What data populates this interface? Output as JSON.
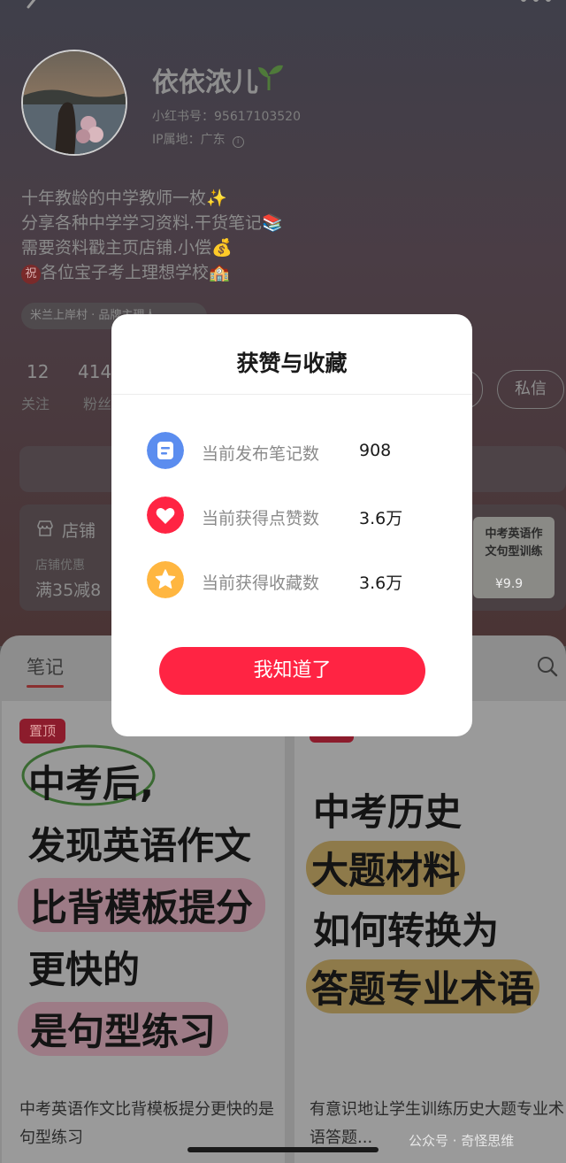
{
  "profile": {
    "nickname": "依依浓儿",
    "red_id": "小红书号：95617103520",
    "ip_location": "IP属地：广东",
    "bio": [
      "十年教龄的中学教师一枚✨",
      "分享各种中学学习资料.干货笔记📚",
      "需要资料戳主页店铺.小偿💰",
      "各位宝子考上理想学校🏫"
    ],
    "bio_badge": "祝",
    "tag": "米兰上岸村 · 品牌主理人",
    "following": "12",
    "following_label": "关注",
    "followers": "414",
    "followers_label": "粉丝",
    "message_button": "私信"
  },
  "shop": {
    "title": "店铺",
    "discount_label": "店铺优惠",
    "discount": "满35减8",
    "product_title": "中考英语作文句型训练",
    "product_price": "¥9.9"
  },
  "notes": {
    "tab": "笔记",
    "cards": [
      {
        "pin": "置顶",
        "lines": [
          "中考后,",
          "发现英语作文",
          "比背模板提分",
          "更快的",
          "是句型练习"
        ],
        "caption": "中考英语作文比背模板提分更快的是句型练习"
      },
      {
        "lines": [
          "中考历史",
          "大题材料",
          "如何转换为",
          "答题专业术语"
        ],
        "caption": "有意识地让学生训练历史大题专业术语答题..."
      }
    ]
  },
  "dialog": {
    "title": "获赞与收藏",
    "rows": [
      {
        "label": "当前发布笔记数",
        "value": "908",
        "icon": "note-icon",
        "color": "#5b8def"
      },
      {
        "label": "当前获得点赞数",
        "value": "3.6万",
        "icon": "heart-icon",
        "color": "#ff2443"
      },
      {
        "label": "当前获得收藏数",
        "value": "3.6万",
        "icon": "star-icon",
        "color": "#ffb640"
      }
    ],
    "confirm": "我知道了"
  },
  "watermark": "公众号 · 奇怪思维"
}
